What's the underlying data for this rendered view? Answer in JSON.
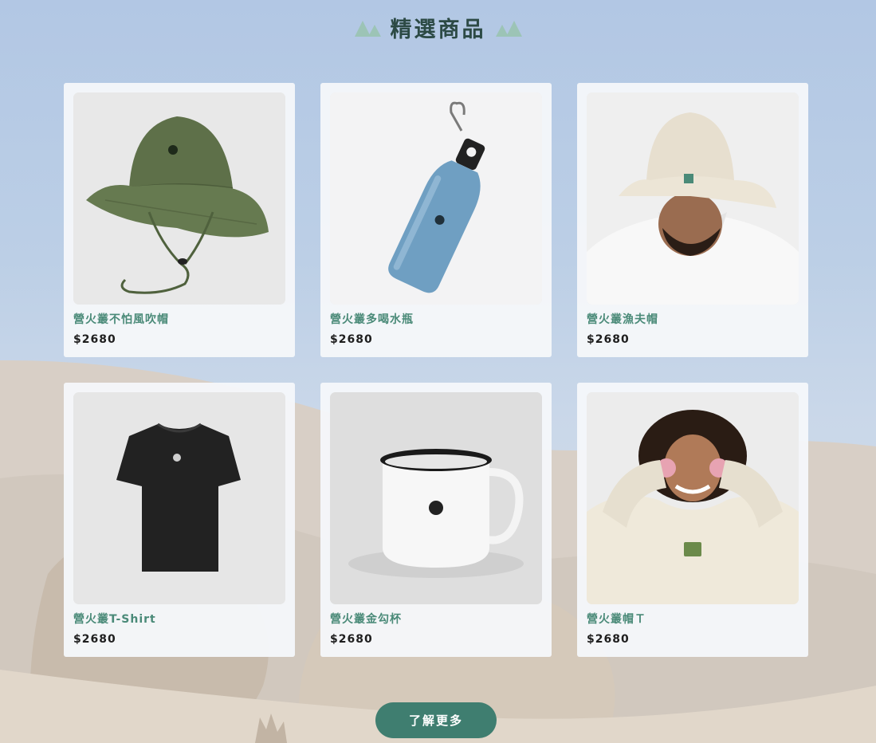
{
  "section": {
    "title": "精選商品"
  },
  "products": [
    {
      "name": "營火叢不怕風吹帽",
      "price": "$2680",
      "icon": "bucket-hat-green"
    },
    {
      "name": "營火叢多喝水瓶",
      "price": "$2680",
      "icon": "water-bottle-blue"
    },
    {
      "name": "營火叢漁夫帽",
      "price": "$2680",
      "icon": "bucket-hat-beige-model"
    },
    {
      "name": "營火叢T-Shirt",
      "price": "$2680",
      "icon": "tshirt-black"
    },
    {
      "name": "營火叢金勾杯",
      "price": "$2680",
      "icon": "enamel-mug-white"
    },
    {
      "name": "營火叢帽Ｔ",
      "price": "$2680",
      "icon": "hoodie-cream-model"
    }
  ],
  "cta": {
    "label": "了解更多"
  },
  "colors": {
    "accent": "#3f7e70",
    "product_name": "#4a8a78",
    "title": "#2c4a45",
    "sky": "#b2c7e4",
    "sand": "#dcd2c4"
  }
}
